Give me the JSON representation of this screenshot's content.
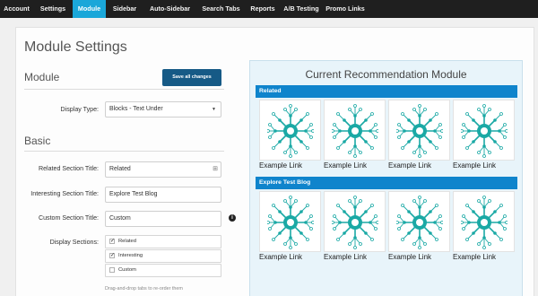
{
  "nav": {
    "tabs": [
      {
        "label": "Account"
      },
      {
        "label": "Settings"
      },
      {
        "label": "Module"
      },
      {
        "label": "Sidebar"
      },
      {
        "label": "Auto-Sidebar"
      },
      {
        "label": "Search Tabs"
      },
      {
        "label": "Reports"
      },
      {
        "label": "A/B Testing"
      },
      {
        "label": "Promo Links"
      }
    ],
    "active_tab": "Module"
  },
  "page": {
    "title": "Module Settings"
  },
  "module_section": {
    "title": "Module",
    "save_label": "Save all changes",
    "display_type": {
      "label": "Display Type:",
      "value": "Blocks - Text Under"
    }
  },
  "basic_section": {
    "title": "Basic",
    "related_title": {
      "label": "Related Section Title:",
      "value": "Related"
    },
    "interesting_title": {
      "label": "Interesting Section Title:",
      "value": "Explore Test Blog"
    },
    "custom_title": {
      "label": "Custom Section Title:",
      "value": "Custom"
    },
    "display_sections": {
      "label": "Display Sections:",
      "items": [
        {
          "label": "Related",
          "checked": true
        },
        {
          "label": "Interesting",
          "checked": true
        },
        {
          "label": "Custom",
          "checked": false
        }
      ],
      "hint": "Drag-and-drop tabs to re-order them"
    }
  },
  "preview": {
    "title": "Current Recommendation Module",
    "sections": [
      {
        "title": "Related",
        "links": [
          "Example Link",
          "Example Link",
          "Example Link",
          "Example Link"
        ]
      },
      {
        "title": "Explore Test Blog",
        "links": [
          "Example Link",
          "Example Link",
          "Example Link",
          "Example Link"
        ]
      }
    ]
  },
  "colors": {
    "nav_bg": "#1f1f1f",
    "active_tab": "#1aa7d9",
    "save_button": "#165a86",
    "section_bar": "#0f84cc",
    "hub_icon": "#1aa9a5"
  },
  "icons": {
    "card_image": "network-hub-icon",
    "info": "info-icon",
    "dropdown": "caret-down-icon"
  }
}
